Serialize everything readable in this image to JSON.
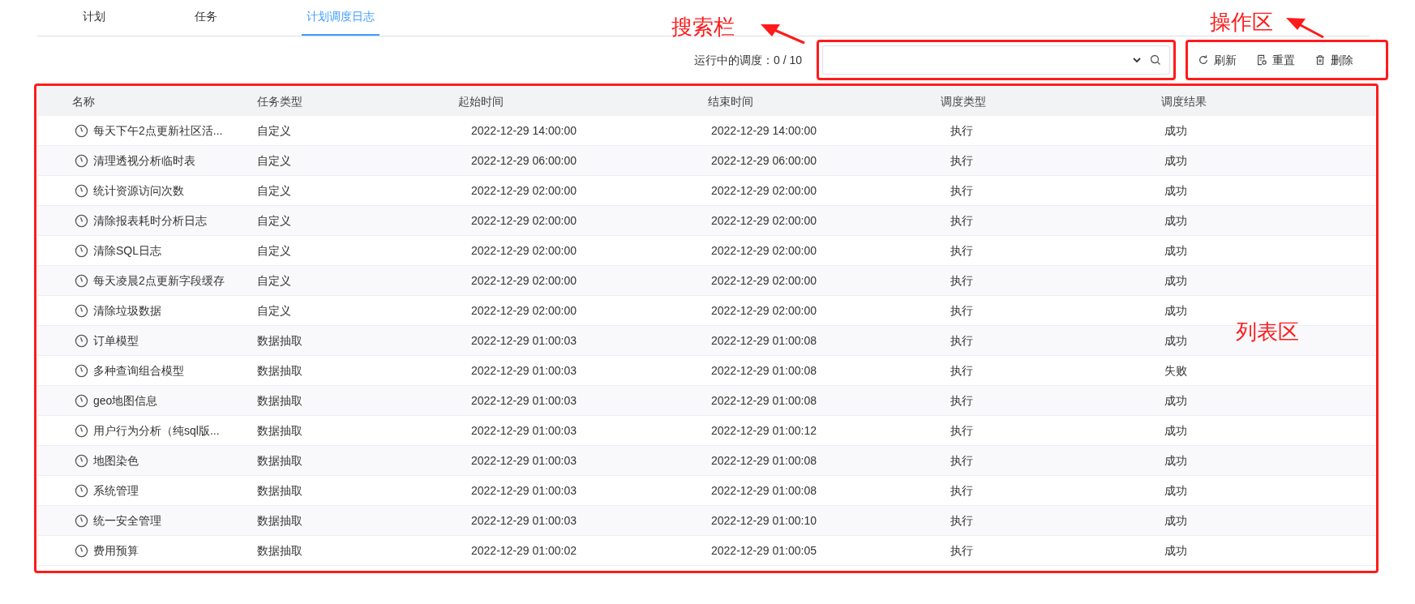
{
  "tabs": [
    {
      "label": "计划",
      "selected": false
    },
    {
      "label": "任务",
      "selected": false
    },
    {
      "label": "计划调度日志",
      "selected": true
    }
  ],
  "status": "运行中的调度：0 / 10",
  "actions": [
    {
      "kind": "refresh",
      "label": "刷新"
    },
    {
      "kind": "reset",
      "label": "重置"
    },
    {
      "kind": "delete",
      "label": "删除"
    }
  ],
  "table": {
    "columns": [
      "名称",
      "任务类型",
      "起始时间",
      "结束时间",
      "调度类型",
      "调度结果"
    ],
    "rows": [
      [
        "每天下午2点更新社区活...",
        "自定义",
        "2022-12-29 14:00:00",
        "2022-12-29 14:00:00",
        "执行",
        "成功"
      ],
      [
        "清理透视分析临时表",
        "自定义",
        "2022-12-29 06:00:00",
        "2022-12-29 06:00:00",
        "执行",
        "成功"
      ],
      [
        "统计资源访问次数",
        "自定义",
        "2022-12-29 02:00:00",
        "2022-12-29 02:00:00",
        "执行",
        "成功"
      ],
      [
        "清除报表耗时分析日志",
        "自定义",
        "2022-12-29 02:00:00",
        "2022-12-29 02:00:00",
        "执行",
        "成功"
      ],
      [
        "清除SQL日志",
        "自定义",
        "2022-12-29 02:00:00",
        "2022-12-29 02:00:00",
        "执行",
        "成功"
      ],
      [
        "每天凌晨2点更新字段缓存",
        "自定义",
        "2022-12-29 02:00:00",
        "2022-12-29 02:00:00",
        "执行",
        "成功"
      ],
      [
        "清除垃圾数据",
        "自定义",
        "2022-12-29 02:00:00",
        "2022-12-29 02:00:00",
        "执行",
        "成功"
      ],
      [
        "订单模型",
        "数据抽取",
        "2022-12-29 01:00:03",
        "2022-12-29 01:00:08",
        "执行",
        "成功"
      ],
      [
        "多种查询组合模型",
        "数据抽取",
        "2022-12-29 01:00:03",
        "2022-12-29 01:00:08",
        "执行",
        "失败"
      ],
      [
        "geo地图信息",
        "数据抽取",
        "2022-12-29 01:00:03",
        "2022-12-29 01:00:08",
        "执行",
        "成功"
      ],
      [
        "用户行为分析（纯sql版...",
        "数据抽取",
        "2022-12-29 01:00:03",
        "2022-12-29 01:00:12",
        "执行",
        "成功"
      ],
      [
        "地图染色",
        "数据抽取",
        "2022-12-29 01:00:03",
        "2022-12-29 01:00:08",
        "执行",
        "成功"
      ],
      [
        "系统管理",
        "数据抽取",
        "2022-12-29 01:00:03",
        "2022-12-29 01:00:08",
        "执行",
        "成功"
      ],
      [
        "统一安全管理",
        "数据抽取",
        "2022-12-29 01:00:03",
        "2022-12-29 01:00:10",
        "执行",
        "成功"
      ],
      [
        "费用预算",
        "数据抽取",
        "2022-12-29 01:00:02",
        "2022-12-29 01:00:05",
        "执行",
        "成功"
      ]
    ]
  },
  "annotations": {
    "search": "搜索栏",
    "actions": "操作区",
    "list": "列表区"
  }
}
